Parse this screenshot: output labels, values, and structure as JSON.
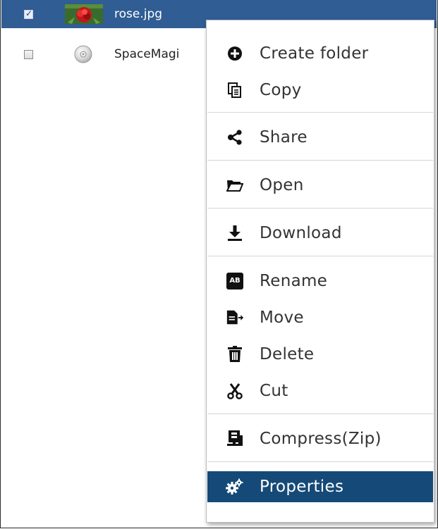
{
  "files": [
    {
      "name": "rose.jpg",
      "checked": true,
      "icon": "image-thumbnail"
    },
    {
      "name": "SpaceMagi",
      "checked": false,
      "icon": "disc-icon"
    }
  ],
  "context_menu": {
    "items": [
      {
        "label": "Create folder",
        "icon": "plus-circle-icon"
      },
      {
        "label": "Copy",
        "icon": "copy-icon"
      },
      {
        "label": "Share",
        "icon": "share-icon"
      },
      {
        "label": "Open",
        "icon": "folder-open-icon"
      },
      {
        "label": "Download",
        "icon": "download-icon"
      },
      {
        "label": "Rename",
        "icon": "rename-icon",
        "badge": "AB"
      },
      {
        "label": "Move",
        "icon": "move-icon"
      },
      {
        "label": "Delete",
        "icon": "trash-icon"
      },
      {
        "label": "Cut",
        "icon": "scissors-icon"
      },
      {
        "label": "Compress(Zip)",
        "icon": "compress-icon"
      },
      {
        "label": "Properties",
        "icon": "gears-icon"
      }
    ],
    "active_item": "Properties"
  },
  "colors": {
    "selected_row": "#2f5d94",
    "active_menu_item": "#154a78",
    "menu_text": "#333333"
  }
}
